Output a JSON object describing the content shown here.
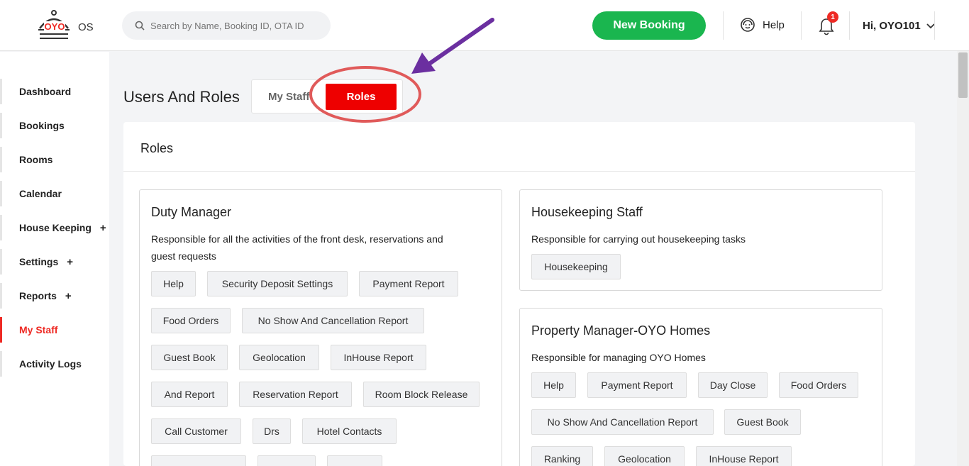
{
  "header": {
    "logo_text": "OYO",
    "logo_suffix": "OS",
    "search_placeholder": "Search by Name, Booking ID, OTA ID",
    "new_booking_label": "New Booking",
    "help_label": "Help",
    "notification_count": "1",
    "user_greeting": "Hi, OYO101"
  },
  "sidebar": {
    "items": [
      {
        "label": "Dashboard"
      },
      {
        "label": "Bookings"
      },
      {
        "label": "Rooms"
      },
      {
        "label": "Calendar"
      },
      {
        "label": "House Keeping",
        "plus": "+"
      },
      {
        "label": "Settings",
        "plus": "+"
      },
      {
        "label": "Reports",
        "plus": "+"
      },
      {
        "label": "My Staff"
      },
      {
        "label": "Activity Logs"
      }
    ]
  },
  "page": {
    "title": "Users And Roles",
    "tabs": [
      {
        "label": "My Staff"
      },
      {
        "label": "Roles"
      }
    ],
    "section_title": "Roles"
  },
  "roles": {
    "duty_manager": {
      "title": "Duty Manager",
      "desc_line1": "Responsible for all the activities of the front desk, reservations and",
      "desc_line2": "guest requests",
      "permissions": [
        "Help",
        "Security Deposit Settings",
        "Payment Report",
        "Food Orders",
        "No Show And Cancellation Report",
        "Guest Book",
        "Geolocation",
        "InHouse Report",
        "And Report",
        "Reservation Report",
        "Room Block Release",
        "Call Customer",
        "Drs",
        "Hotel Contacts"
      ]
    },
    "housekeeping_staff": {
      "title": "Housekeeping Staff",
      "desc": "Responsible for carrying out housekeeping tasks",
      "permissions": [
        "Housekeeping"
      ]
    },
    "property_manager": {
      "title": "Property Manager-OYO Homes",
      "desc": "Responsible for managing OYO Homes",
      "permissions": [
        "Help",
        "Payment Report",
        "Day Close",
        "Food Orders",
        "No Show And Cancellation Report",
        "Guest Book",
        "Ranking",
        "Geolocation",
        "InHouse Report"
      ]
    }
  },
  "colors": {
    "brand_red": "#ee2a24",
    "green": "#1ab64f",
    "annotation_purple": "#6b2fa0",
    "annotation_circle": "#e05a5a"
  }
}
